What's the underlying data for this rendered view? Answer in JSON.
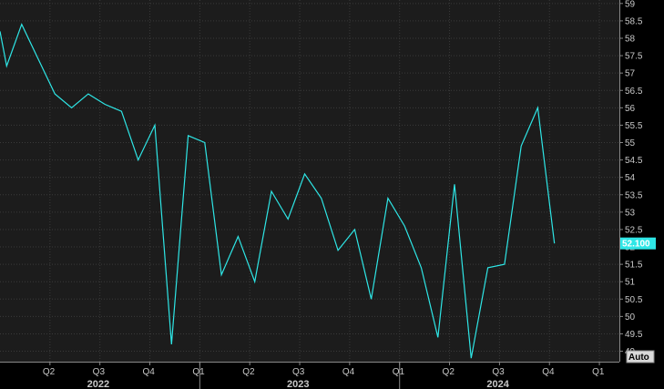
{
  "chart_data": {
    "type": "line",
    "ylim": [
      48.7,
      59.1
    ],
    "yticks": [
      49,
      49.5,
      50,
      50.5,
      51,
      51.5,
      52,
      52.5,
      53,
      53.5,
      54,
      54.5,
      55,
      55.5,
      56,
      56.5,
      57,
      57.5,
      58,
      58.5,
      59
    ],
    "ytick_labels": [
      "49",
      "49.5",
      "50",
      "50.5",
      "51",
      "51.5",
      "52",
      "52.5",
      "53",
      "53.5",
      "54",
      "54.5",
      "55",
      "55.5",
      "56",
      "56.5",
      "57",
      "57.5",
      "58",
      "58.5",
      "59"
    ],
    "xticks": [
      {
        "label": "Q2",
        "x": 3
      },
      {
        "label": "Q3",
        "x": 6
      },
      {
        "label": "Q4",
        "x": 9
      },
      {
        "label": "Q1",
        "x": 12
      },
      {
        "label": "Q2",
        "x": 15
      },
      {
        "label": "Q3",
        "x": 18
      },
      {
        "label": "Q4",
        "x": 21
      },
      {
        "label": "Q1",
        "x": 24
      },
      {
        "label": "Q2",
        "x": 27
      },
      {
        "label": "Q3",
        "x": 30
      },
      {
        "label": "Q4",
        "x": 33
      },
      {
        "label": "Q1",
        "x": 36
      }
    ],
    "years": [
      {
        "label": "2022",
        "x": 6
      },
      {
        "label": "2023",
        "x": 18
      },
      {
        "label": "2024",
        "x": 30
      }
    ],
    "year_boundaries": [
      12,
      24
    ],
    "xlim": [
      0,
      37.2
    ],
    "series": [
      {
        "color": "#2ee6e6",
        "points": [
          [
            0,
            58.2
          ],
          [
            0.4,
            57.2
          ],
          [
            1.3,
            58.4
          ],
          [
            2.3,
            57.4
          ],
          [
            3.3,
            56.4
          ],
          [
            4.3,
            56.0
          ],
          [
            5.3,
            56.4
          ],
          [
            6.3,
            56.1
          ],
          [
            7.3,
            55.9
          ],
          [
            8.3,
            54.5
          ],
          [
            9.3,
            55.5
          ],
          [
            10.3,
            49.2
          ],
          [
            11.3,
            55.2
          ],
          [
            12.3,
            55.0
          ],
          [
            13.3,
            51.2
          ],
          [
            14.3,
            52.3
          ],
          [
            15.3,
            51.0
          ],
          [
            16.3,
            53.6
          ],
          [
            17.3,
            52.8
          ],
          [
            18.3,
            54.1
          ],
          [
            19.3,
            53.4
          ],
          [
            20.3,
            51.9
          ],
          [
            21.3,
            52.5
          ],
          [
            22.3,
            50.5
          ],
          [
            23.3,
            53.4
          ],
          [
            24.3,
            52.6
          ],
          [
            25.3,
            51.4
          ],
          [
            26.3,
            49.4
          ],
          [
            27.3,
            53.8
          ],
          [
            28.3,
            48.8
          ],
          [
            29.3,
            51.4
          ],
          [
            30.3,
            51.5
          ],
          [
            31.3,
            54.9
          ],
          [
            32.3,
            56.0
          ],
          [
            33.3,
            52.1
          ]
        ]
      }
    ],
    "last_value_label": "52.100",
    "last_value": 52.1,
    "grid": true,
    "axis_button": "Auto"
  }
}
